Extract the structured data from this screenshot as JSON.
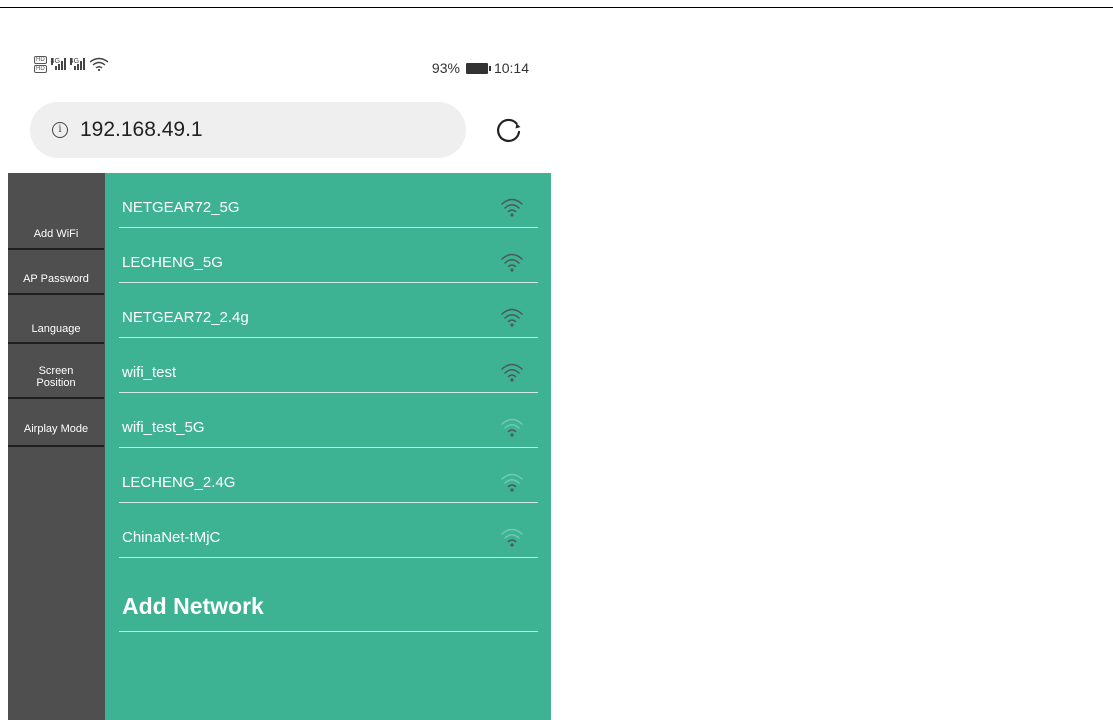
{
  "status_bar": {
    "hd_badges": [
      "HD",
      "HD"
    ],
    "network_labels": [
      "4G",
      "4G"
    ],
    "battery": "93%",
    "time": "10:14",
    "icons": [
      "hd-icon",
      "signal-icon",
      "signal-icon",
      "wifi-icon",
      "battery-icon"
    ]
  },
  "browser": {
    "url": "192.168.49.1",
    "info_icon_glyph": "i",
    "icons": [
      "info-icon",
      "reload-icon"
    ]
  },
  "sidebar": {
    "items": [
      {
        "label": "Add WiFi"
      },
      {
        "label": "AP Password"
      },
      {
        "label": "Language"
      },
      {
        "label": "Screen Position"
      },
      {
        "label": "Airplay Mode"
      }
    ]
  },
  "networks": [
    {
      "name": "NETGEAR72_5G",
      "signal_bars": 3
    },
    {
      "name": "LECHENG_5G",
      "signal_bars": 3
    },
    {
      "name": "NETGEAR72_2.4g",
      "signal_bars": 3
    },
    {
      "name": "wifi_test",
      "signal_bars": 3
    },
    {
      "name": "wifi_test_5G",
      "signal_bars": 1
    },
    {
      "name": "LECHENG_2.4G",
      "signal_bars": 1
    },
    {
      "name": "ChinaNet-tMjC",
      "signal_bars": 1
    }
  ],
  "add_network_label": "Add Network",
  "colors": {
    "main_bg": "#3db394",
    "sidebar_bg": "#4f4f4f",
    "sidebar_divider": "#1e1e1e",
    "wifi_strong": "#4a5a55",
    "wifi_weak": "#6fcab2",
    "url_bar_bg": "#efefef"
  }
}
